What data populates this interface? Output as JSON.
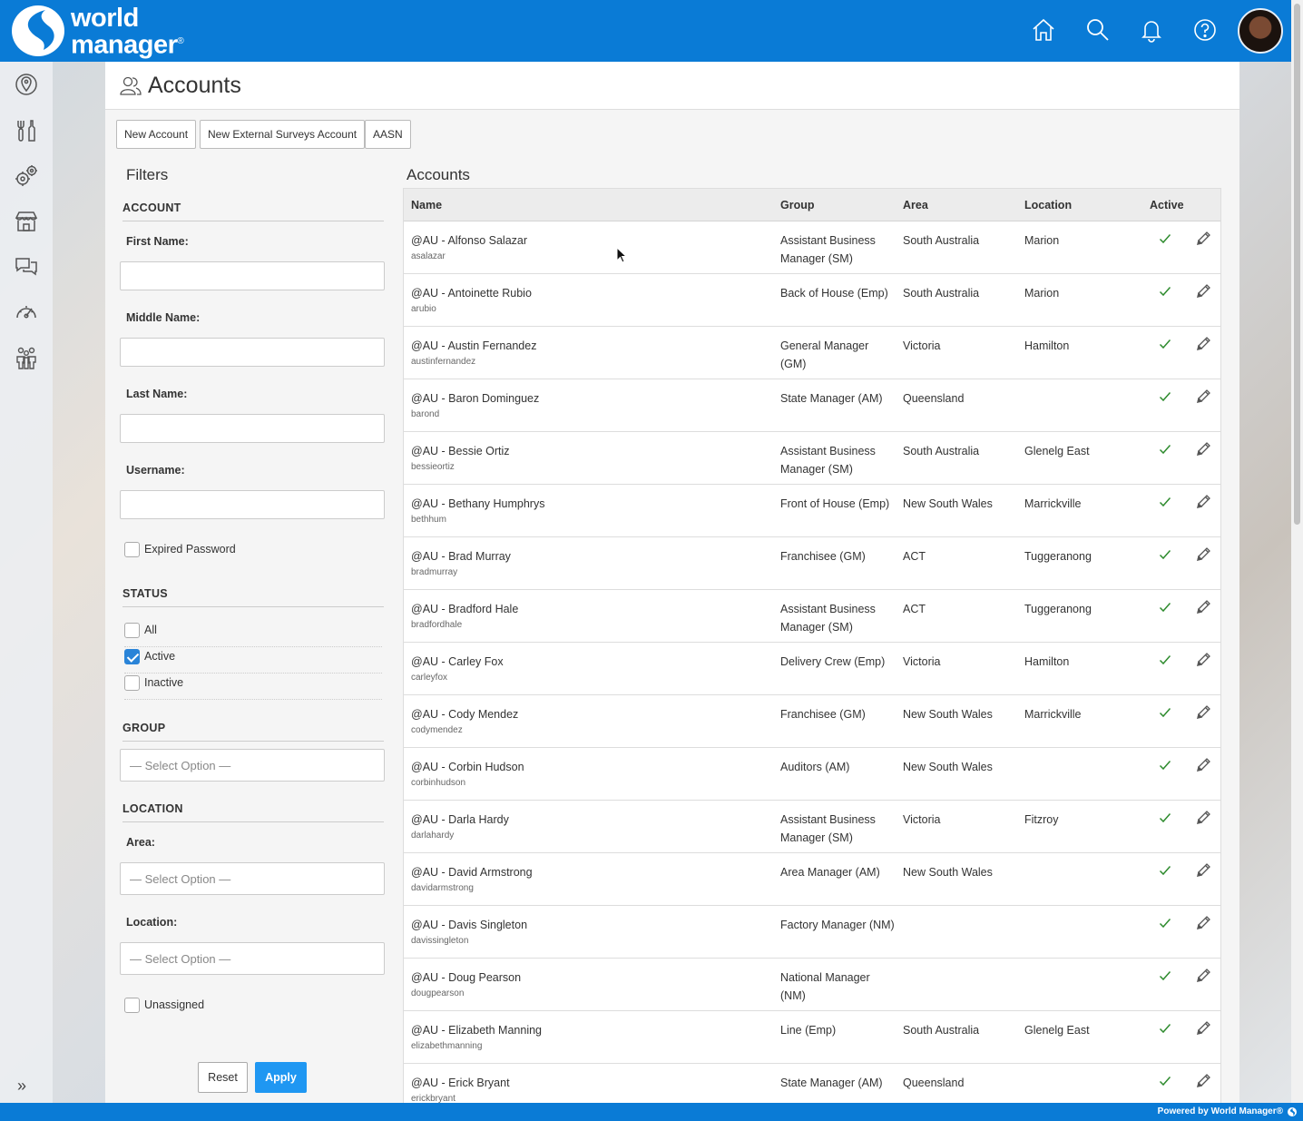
{
  "brand": {
    "line1": "world",
    "line2": "manager",
    "reg_mark": "®",
    "primary_color": "#0a7bd6",
    "accent_color": "#1f97f2"
  },
  "header_icons": [
    "home-icon",
    "search-icon",
    "bell-icon",
    "help-icon"
  ],
  "sidebar_icons": [
    "map-pin-icon",
    "tools-icon",
    "gears-icon",
    "store-icon",
    "chat-icon",
    "speedometer-icon",
    "people-icon",
    "expand-icon"
  ],
  "page": {
    "title": "Accounts"
  },
  "toolbar": {
    "new_account": "New Account",
    "new_external": "New External Surveys Account",
    "aasn": "AASN"
  },
  "filters": {
    "title": "Filters",
    "account_heading": "ACCOUNT",
    "first_name_label": "First Name:",
    "first_name_value": "",
    "middle_name_label": "Middle Name:",
    "middle_name_value": "",
    "last_name_label": "Last Name:",
    "last_name_value": "",
    "username_label": "Username:",
    "username_value": "",
    "expired_password_label": "Expired Password",
    "status_heading": "STATUS",
    "status_all": "All",
    "status_active": "Active",
    "status_inactive": "Inactive",
    "group_heading": "GROUP",
    "group_select": "— Select Option —",
    "location_heading": "LOCATION",
    "area_label": "Area:",
    "area_select": "— Select Option —",
    "location_label": "Location:",
    "location_select": "— Select Option —",
    "unassigned_label": "Unassigned",
    "reset": "Reset",
    "apply": "Apply"
  },
  "accounts": {
    "title": "Accounts",
    "columns": {
      "name": "Name",
      "group": "Group",
      "area": "Area",
      "location": "Location",
      "active": "Active"
    },
    "rows": [
      {
        "name": "@AU - Alfonso Salazar",
        "username": "asalazar",
        "group": "Assistant Business Manager (SM)",
        "area": "South Australia",
        "location": "Marion",
        "active": true
      },
      {
        "name": "@AU - Antoinette Rubio",
        "username": "arubio",
        "group": "Back of House (Emp)",
        "area": "South Australia",
        "location": "Marion",
        "active": true
      },
      {
        "name": "@AU - Austin Fernandez",
        "username": "austinfernandez",
        "group": "General Manager (GM)",
        "area": "Victoria",
        "location": "Hamilton",
        "active": true
      },
      {
        "name": "@AU - Baron Dominguez",
        "username": "barond",
        "group": "State Manager (AM)",
        "area": "Queensland",
        "location": "",
        "active": true
      },
      {
        "name": "@AU - Bessie Ortiz",
        "username": "bessieortiz",
        "group": "Assistant Business Manager (SM)",
        "area": "South Australia",
        "location": "Glenelg East",
        "active": true
      },
      {
        "name": "@AU - Bethany Humphrys",
        "username": "bethhum",
        "group": "Front of House (Emp)",
        "area": "New South Wales",
        "location": "Marrickville",
        "active": true
      },
      {
        "name": "@AU - Brad Murray",
        "username": "bradmurray",
        "group": "Franchisee (GM)",
        "area": "ACT",
        "location": "Tuggeranong",
        "active": true
      },
      {
        "name": "@AU - Bradford Hale",
        "username": "bradfordhale",
        "group": "Assistant Business Manager (SM)",
        "area": "ACT",
        "location": "Tuggeranong",
        "active": true
      },
      {
        "name": "@AU - Carley Fox",
        "username": "carleyfox",
        "group": "Delivery Crew (Emp)",
        "area": "Victoria",
        "location": "Hamilton",
        "active": true
      },
      {
        "name": "@AU - Cody Mendez",
        "username": "codymendez",
        "group": "Franchisee (GM)",
        "area": "New South Wales",
        "location": "Marrickville",
        "active": true
      },
      {
        "name": "@AU - Corbin Hudson",
        "username": "corbinhudson",
        "group": "Auditors (AM)",
        "area": "New South Wales",
        "location": "",
        "active": true
      },
      {
        "name": "@AU - Darla Hardy",
        "username": "darlahardy",
        "group": "Assistant Business Manager (SM)",
        "area": "Victoria",
        "location": "Fitzroy",
        "active": true
      },
      {
        "name": "@AU - David Armstrong",
        "username": "davidarmstrong",
        "group": "Area Manager (AM)",
        "area": "New South Wales",
        "location": "",
        "active": true
      },
      {
        "name": "@AU - Davis Singleton",
        "username": "davissingleton",
        "group": "Factory Manager (NM)",
        "area": "",
        "location": "",
        "active": true
      },
      {
        "name": "@AU - Doug Pearson",
        "username": "dougpearson",
        "group": "National Manager (NM)",
        "area": "",
        "location": "",
        "active": true
      },
      {
        "name": "@AU - Elizabeth Manning",
        "username": "elizabethmanning",
        "group": "Line (Emp)",
        "area": "South Australia",
        "location": "Glenelg East",
        "active": true
      },
      {
        "name": "@AU - Erick Bryant",
        "username": "erickbryant",
        "group": "State Manager (AM)",
        "area": "Queensland",
        "location": "",
        "active": true
      }
    ]
  },
  "footer": {
    "text": "Powered by World Manager®"
  }
}
